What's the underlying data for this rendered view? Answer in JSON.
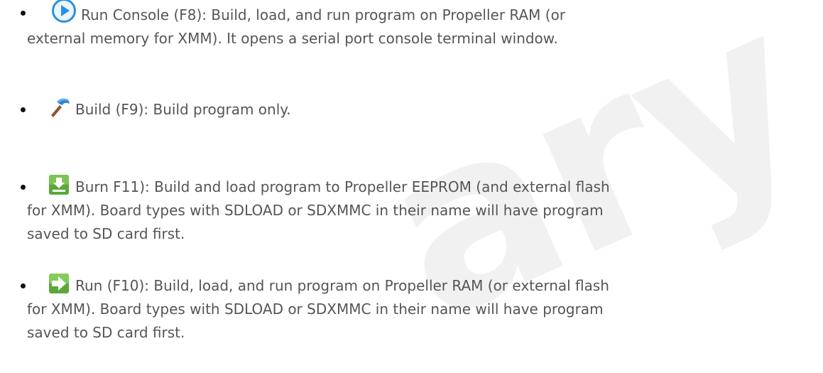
{
  "watermark": "ary",
  "items": [
    {
      "icon": "play-circle-icon",
      "line1": "Run Console (F8): Build, load, and run program on Propeller RAM (or",
      "line2": "external memory for XMM). It opens a serial port console terminal window."
    },
    {
      "icon": "hammer-icon",
      "line1": "Build (F9): Build program only."
    },
    {
      "icon": "download-arrow-icon",
      "line1": "Burn F11): Build and load program to Propeller EEPROM (and external flash",
      "line2": "for XMM). Board types with SDLOAD or SDXMMC in their name will have program",
      "line3": "saved to SD card first."
    },
    {
      "icon": "right-arrow-icon",
      "line1": "Run (F10): Build, load, and run program on Propeller RAM (or external flash",
      "line2": "for XMM). Board types with SDLOAD or SDXMMC in their name will have program",
      "line3": "saved to SD card first."
    }
  ],
  "colors": {
    "text": "#555555",
    "play_blue": "#2b8fe0",
    "hammer_blue": "#2f86d6",
    "hammer_handle": "#8a5a2c",
    "download_green": "#5aa83a",
    "run_green": "#6abf3a"
  }
}
